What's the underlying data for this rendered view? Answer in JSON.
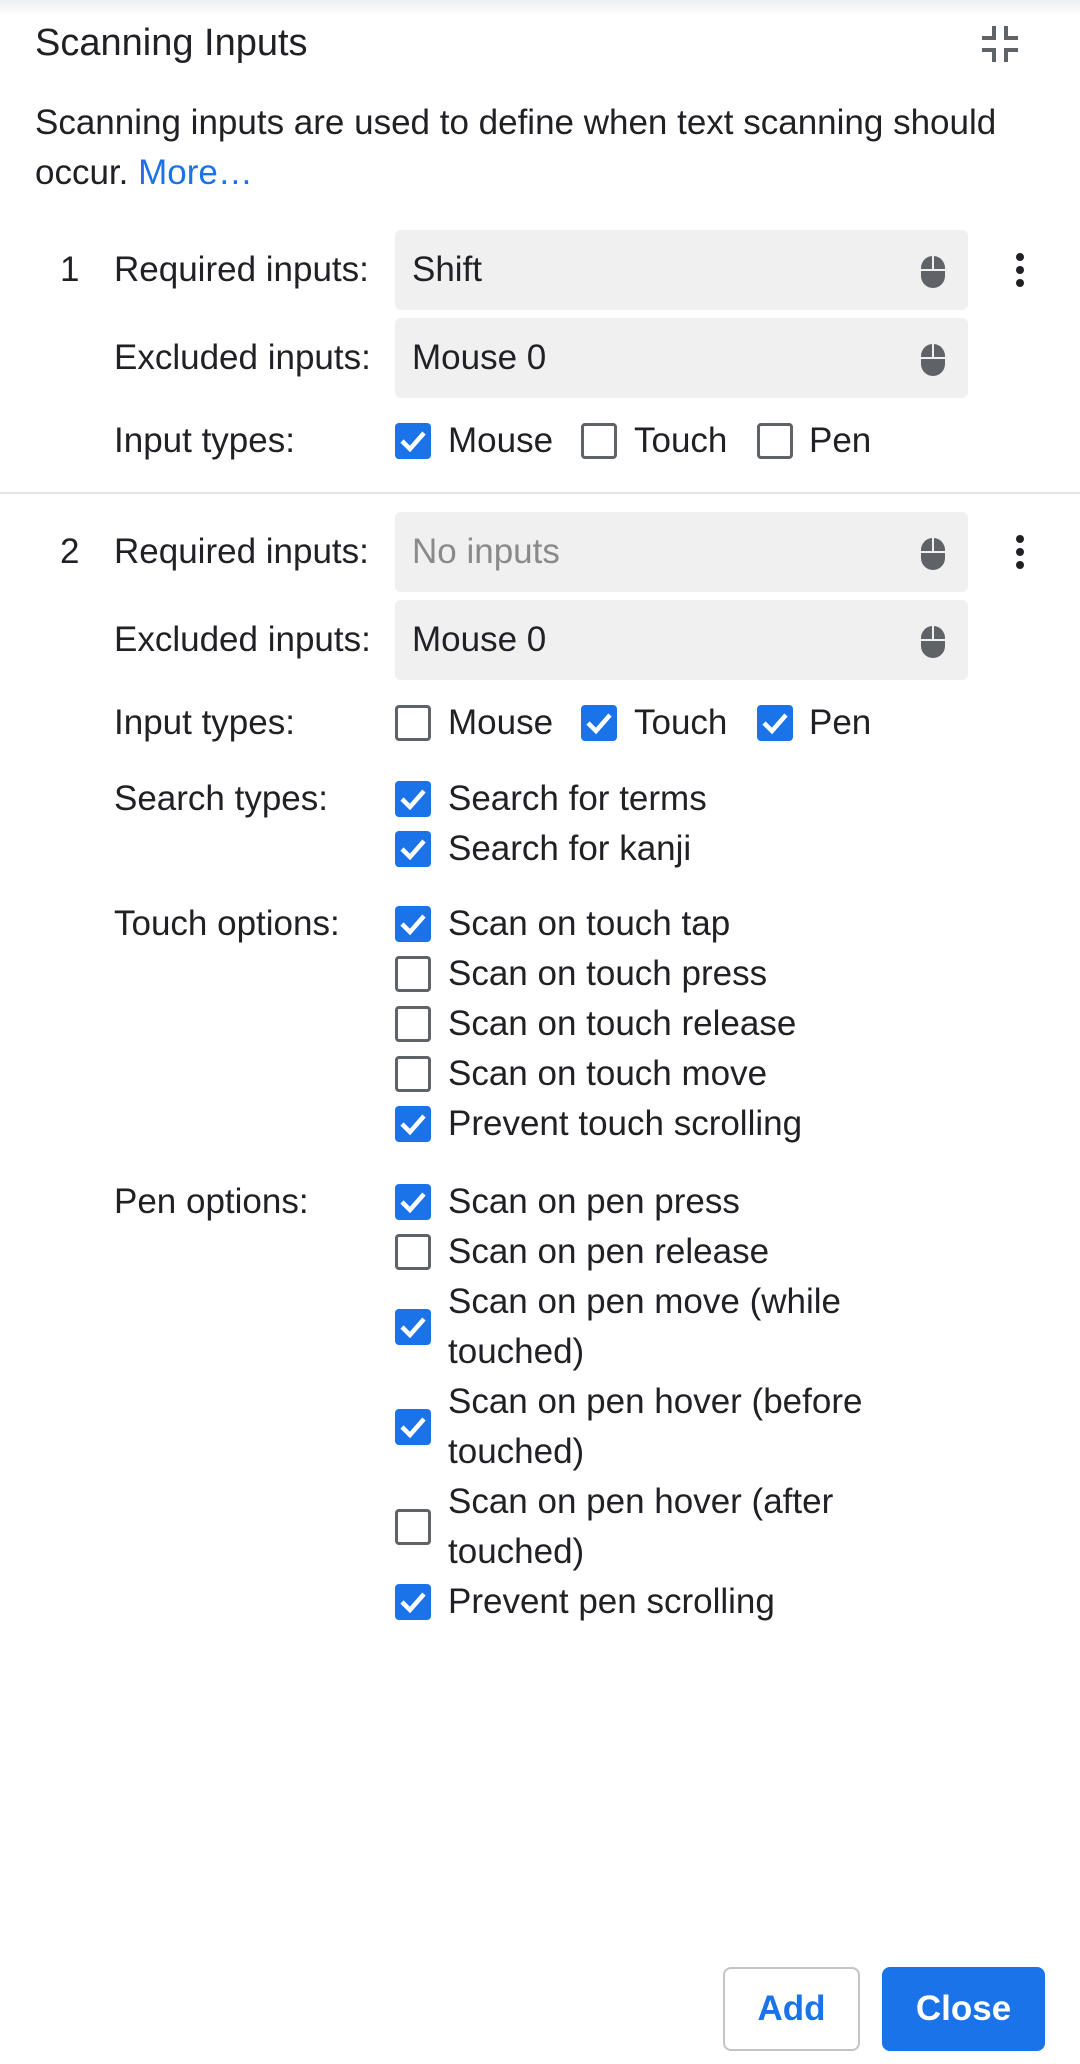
{
  "dialog": {
    "title": "Scanning Inputs",
    "collapse_icon": "collapse-arrows-icon",
    "description": "Scanning inputs are used to define when text scanning should occur.",
    "more_link": "More…"
  },
  "labels": {
    "required_inputs": "Required inputs:",
    "excluded_inputs": "Excluded inputs:",
    "input_types": "Input types:",
    "search_types": "Search types:",
    "touch_options": "Touch options:",
    "pen_options": "Pen options:"
  },
  "inputs": [
    {
      "index": "1",
      "required_value": "Shift",
      "excluded_value": "Mouse 0",
      "input_types": [
        {
          "label": "Mouse",
          "checked": true
        },
        {
          "label": "Touch",
          "checked": false
        },
        {
          "label": "Pen",
          "checked": false
        }
      ]
    },
    {
      "index": "2",
      "required_placeholder": "No inputs",
      "excluded_value": "Mouse 0",
      "input_types": [
        {
          "label": "Mouse",
          "checked": false
        },
        {
          "label": "Touch",
          "checked": true
        },
        {
          "label": "Pen",
          "checked": true
        }
      ],
      "search_types": [
        {
          "label": "Search for terms",
          "checked": true
        },
        {
          "label": "Search for kanji",
          "checked": true
        }
      ],
      "touch_options": [
        {
          "label": "Scan on touch tap",
          "checked": true
        },
        {
          "label": "Scan on touch press",
          "checked": false
        },
        {
          "label": "Scan on touch release",
          "checked": false
        },
        {
          "label": "Scan on touch move",
          "checked": false
        },
        {
          "label": "Prevent touch scrolling",
          "checked": true
        }
      ],
      "pen_options": [
        {
          "label": "Scan on pen press",
          "checked": true
        },
        {
          "label": "Scan on pen release",
          "checked": false
        },
        {
          "label": "Scan on pen move (while",
          "label2": "touched)",
          "checked": true
        },
        {
          "label": "Scan on pen hover (before",
          "label2": "touched)",
          "checked": true
        },
        {
          "label": "Scan on pen hover (after",
          "label2": "touched)",
          "checked": false
        },
        {
          "label": "Prevent pen scrolling",
          "checked": true
        }
      ]
    }
  ],
  "buttons": {
    "add": "Add",
    "close": "Close"
  },
  "colors": {
    "accent": "#1a73e8",
    "field_bg": "#f0f0f0",
    "checkbox_border": "#5f6368"
  }
}
